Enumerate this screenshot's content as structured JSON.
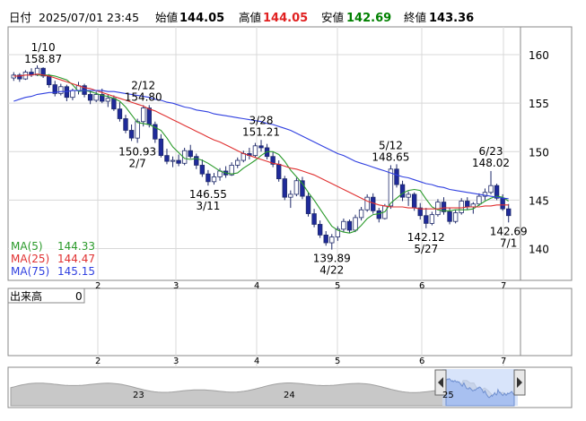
{
  "header": {
    "date_label": "日付",
    "datetime": "2025/07/01 23:45",
    "open_label": "始値",
    "open": "144.05",
    "high_label": "高値",
    "high": "144.05",
    "low_label": "安値",
    "low": "142.69",
    "close_label": "終値",
    "close": "143.36"
  },
  "colors": {
    "up_candle": "#ffffff",
    "down_candle": "#1f2a9a",
    "ma5": "#2a9a2a",
    "ma25": "#e03030",
    "ma75": "#3040e0",
    "grid": "#d8d8d8"
  },
  "volume": {
    "label": "出来高",
    "value": "0"
  },
  "navigator": {
    "labels": [
      "23",
      "24",
      "25"
    ]
  },
  "chart_data": {
    "type": "candlestick",
    "yticks": [
      140,
      145,
      150,
      155,
      160
    ],
    "ylim": [
      137.0,
      162.5
    ],
    "xlim": [
      0,
      135
    ],
    "month_ticks": [
      {
        "label": "2",
        "x": 23
      },
      {
        "label": "3",
        "x": 43
      },
      {
        "label": "4",
        "x": 63
      },
      {
        "label": "5",
        "x": 84
      },
      {
        "label": "6",
        "x": 106
      },
      {
        "label": "7",
        "x": 127
      }
    ],
    "ohlc": [
      [
        157.6,
        158.2,
        157.3,
        157.9
      ],
      [
        157.9,
        158.1,
        157.2,
        157.5
      ],
      [
        157.5,
        158.4,
        157.4,
        158.2
      ],
      [
        158.2,
        158.6,
        157.7,
        157.9
      ],
      [
        157.9,
        158.9,
        157.8,
        158.6
      ],
      [
        158.6,
        158.7,
        157.6,
        157.8
      ],
      [
        157.8,
        158.0,
        156.6,
        156.9
      ],
      [
        156.9,
        157.3,
        155.7,
        156.0
      ],
      [
        156.0,
        157.0,
        155.8,
        156.7
      ],
      [
        156.7,
        156.9,
        155.2,
        155.6
      ],
      [
        155.6,
        156.5,
        155.3,
        156.3
      ],
      [
        156.3,
        157.2,
        155.9,
        156.8
      ],
      [
        156.8,
        157.0,
        155.6,
        155.9
      ],
      [
        155.9,
        156.3,
        154.9,
        155.3
      ],
      [
        155.3,
        156.2,
        155.1,
        155.9
      ],
      [
        155.9,
        156.5,
        155.0,
        155.2
      ],
      [
        155.2,
        155.9,
        154.6,
        155.5
      ],
      [
        155.5,
        155.8,
        154.2,
        154.4
      ],
      [
        154.4,
        155.1,
        153.1,
        153.4
      ],
      [
        153.4,
        153.8,
        151.9,
        152.2
      ],
      [
        152.2,
        152.8,
        151.1,
        151.4
      ],
      [
        151.4,
        153.4,
        150.9,
        153.1
      ],
      [
        153.1,
        154.8,
        152.6,
        154.5
      ],
      [
        154.5,
        154.8,
        152.5,
        152.8
      ],
      [
        152.8,
        153.1,
        150.9,
        151.3
      ],
      [
        151.3,
        151.8,
        149.4,
        149.6
      ],
      [
        149.6,
        150.3,
        148.7,
        149.0
      ],
      [
        149.0,
        149.5,
        148.4,
        149.1
      ],
      [
        149.1,
        149.7,
        148.5,
        148.8
      ],
      [
        148.8,
        150.4,
        148.6,
        150.1
      ],
      [
        150.1,
        150.7,
        149.3,
        149.5
      ],
      [
        149.5,
        149.8,
        148.2,
        148.6
      ],
      [
        148.6,
        149.2,
        147.4,
        147.7
      ],
      [
        147.7,
        148.1,
        146.5,
        146.9
      ],
      [
        146.9,
        147.8,
        146.6,
        147.4
      ],
      [
        147.4,
        148.3,
        147.0,
        148.0
      ],
      [
        148.0,
        148.5,
        147.3,
        147.6
      ],
      [
        147.6,
        148.9,
        147.5,
        148.6
      ],
      [
        148.6,
        149.4,
        148.3,
        149.1
      ],
      [
        149.1,
        150.1,
        148.9,
        149.8
      ],
      [
        149.8,
        150.4,
        149.2,
        149.6
      ],
      [
        149.6,
        150.9,
        149.4,
        150.6
      ],
      [
        150.6,
        151.2,
        150.0,
        150.4
      ],
      [
        150.4,
        150.8,
        149.2,
        149.5
      ],
      [
        149.5,
        150.0,
        148.4,
        148.7
      ],
      [
        148.7,
        149.1,
        146.9,
        147.2
      ],
      [
        147.2,
        147.5,
        145.0,
        145.3
      ],
      [
        145.3,
        146.0,
        144.2,
        145.6
      ],
      [
        145.6,
        147.3,
        145.4,
        147.0
      ],
      [
        147.0,
        147.4,
        145.1,
        145.4
      ],
      [
        145.4,
        145.8,
        143.3,
        143.6
      ],
      [
        143.6,
        144.1,
        142.2,
        142.5
      ],
      [
        142.5,
        142.9,
        141.1,
        141.4
      ],
      [
        141.4,
        141.8,
        140.3,
        140.6
      ],
      [
        140.6,
        141.5,
        139.9,
        141.2
      ],
      [
        141.2,
        142.3,
        140.8,
        142.0
      ],
      [
        142.0,
        143.1,
        141.7,
        142.8
      ],
      [
        142.8,
        143.0,
        141.6,
        141.9
      ],
      [
        141.9,
        143.5,
        141.7,
        143.2
      ],
      [
        143.2,
        144.3,
        142.9,
        144.0
      ],
      [
        144.0,
        145.6,
        143.8,
        145.3
      ],
      [
        145.3,
        145.7,
        143.6,
        143.9
      ],
      [
        143.9,
        144.2,
        142.7,
        143.1
      ],
      [
        143.1,
        144.6,
        143.0,
        144.4
      ],
      [
        144.4,
        148.6,
        144.1,
        148.2
      ],
      [
        148.2,
        148.7,
        146.3,
        146.6
      ],
      [
        146.6,
        147.0,
        144.9,
        145.3
      ],
      [
        145.3,
        145.9,
        144.4,
        145.6
      ],
      [
        145.6,
        145.8,
        143.9,
        144.2
      ],
      [
        144.2,
        144.7,
        143.0,
        143.4
      ],
      [
        143.4,
        144.2,
        142.1,
        142.6
      ],
      [
        142.6,
        143.8,
        142.4,
        143.5
      ],
      [
        143.5,
        145.1,
        143.3,
        144.8
      ],
      [
        144.8,
        145.3,
        143.5,
        143.8
      ],
      [
        143.8,
        144.2,
        142.5,
        142.8
      ],
      [
        142.8,
        144.0,
        142.6,
        143.7
      ],
      [
        143.7,
        145.2,
        143.5,
        144.9
      ],
      [
        144.9,
        145.3,
        144.0,
        144.3
      ],
      [
        144.3,
        144.8,
        143.6,
        144.6
      ],
      [
        144.6,
        145.7,
        144.4,
        145.4
      ],
      [
        145.4,
        146.2,
        145.0,
        145.8
      ],
      [
        145.8,
        148.0,
        145.6,
        146.5
      ],
      [
        146.5,
        146.7,
        145.0,
        145.2
      ],
      [
        145.2,
        145.6,
        143.9,
        144.1
      ],
      [
        144.1,
        144.6,
        142.7,
        143.4
      ]
    ],
    "series": [
      {
        "name": "MA(5)",
        "last": "144.33",
        "values": [
          null,
          null,
          null,
          null,
          157.9,
          157.9,
          157.9,
          157.8,
          157.6,
          157.4,
          156.9,
          156.2,
          156.3,
          156.2,
          156.0,
          155.8,
          155.7,
          155.5,
          155.2,
          154.6,
          153.8,
          153.0,
          152.9,
          152.8,
          152.5,
          152.2,
          151.4,
          150.5,
          149.9,
          149.3,
          149.2,
          149.3,
          149.1,
          148.8,
          148.4,
          148.0,
          147.8,
          147.7,
          147.8,
          148.3,
          148.7,
          149.1,
          149.6,
          150.0,
          150.0,
          149.7,
          149.0,
          148.1,
          147.4,
          146.7,
          145.8,
          145.0,
          144.1,
          143.2,
          142.3,
          141.9,
          141.7,
          141.6,
          141.8,
          142.4,
          143.1,
          143.5,
          143.6,
          143.8,
          144.7,
          145.2,
          145.7,
          146.0,
          146.1,
          146.0,
          145.1,
          144.3,
          144.0,
          143.9,
          143.9,
          144.0,
          144.0,
          144.0,
          144.1,
          144.5,
          144.9,
          145.2,
          145.4,
          145.3,
          144.9
        ]
      },
      {
        "name": "MA(25)",
        "last": "144.47",
        "values": [
          157.8,
          157.8,
          157.9,
          157.9,
          158.0,
          157.9,
          157.8,
          157.6,
          157.4,
          157.2,
          157.0,
          156.8,
          156.6,
          156.5,
          156.3,
          156.1,
          155.9,
          155.7,
          155.5,
          155.3,
          155.1,
          154.9,
          154.7,
          154.4,
          154.2,
          153.9,
          153.6,
          153.3,
          153.0,
          152.7,
          152.4,
          152.1,
          151.8,
          151.5,
          151.2,
          151.0,
          150.7,
          150.4,
          150.1,
          149.8,
          149.6,
          149.4,
          149.2,
          149.0,
          148.8,
          148.7,
          148.5,
          148.3,
          148.2,
          148.0,
          147.8,
          147.6,
          147.3,
          147.0,
          146.7,
          146.4,
          146.1,
          145.8,
          145.5,
          145.2,
          144.9,
          144.7,
          144.5,
          144.4,
          144.3,
          144.3,
          144.3,
          144.2,
          144.2,
          144.1,
          144.1,
          144.1,
          144.1,
          144.2,
          144.2,
          144.2,
          144.2,
          144.3,
          144.3,
          144.3,
          144.4,
          144.4,
          144.5,
          144.5,
          144.5
        ]
      },
      {
        "name": "MA(75)",
        "last": "145.15",
        "values": [
          155.2,
          155.4,
          155.6,
          155.7,
          155.9,
          156.0,
          156.1,
          156.1,
          156.2,
          156.2,
          156.3,
          156.3,
          156.3,
          156.3,
          156.3,
          156.3,
          156.2,
          156.2,
          156.1,
          156.0,
          155.9,
          155.8,
          155.7,
          155.6,
          155.4,
          155.3,
          155.1,
          155.0,
          154.8,
          154.6,
          154.5,
          154.3,
          154.2,
          154.1,
          153.9,
          153.8,
          153.7,
          153.6,
          153.5,
          153.4,
          153.3,
          153.2,
          153.1,
          152.9,
          152.8,
          152.6,
          152.4,
          152.2,
          151.9,
          151.6,
          151.3,
          151.0,
          150.7,
          150.4,
          150.1,
          149.8,
          149.6,
          149.3,
          149.0,
          148.8,
          148.6,
          148.4,
          148.2,
          148.0,
          147.8,
          147.6,
          147.4,
          147.3,
          147.1,
          146.9,
          146.7,
          146.6,
          146.4,
          146.3,
          146.1,
          146.0,
          145.9,
          145.8,
          145.7,
          145.6,
          145.5,
          145.4,
          145.3,
          145.2,
          145.15
        ]
      }
    ],
    "annotations": [
      {
        "date": "1/10",
        "value": "158.87",
        "i": 5,
        "pos": "above"
      },
      {
        "date": "2/12",
        "value": "154.80",
        "i": 22,
        "pos": "above"
      },
      {
        "date": "2/7",
        "value": "150.93",
        "i": 21,
        "pos": "below"
      },
      {
        "date": "3/28",
        "value": "151.21",
        "i": 42,
        "pos": "above"
      },
      {
        "date": "3/11",
        "value": "146.55",
        "i": 33,
        "pos": "below"
      },
      {
        "date": "4/22",
        "value": "139.89",
        "i": 54,
        "pos": "below"
      },
      {
        "date": "5/12",
        "value": "148.65",
        "i": 64,
        "pos": "above"
      },
      {
        "date": "5/27",
        "value": "142.12",
        "i": 70,
        "pos": "below"
      },
      {
        "date": "6/23",
        "value": "148.02",
        "i": 81,
        "pos": "above"
      },
      {
        "date": "7/1",
        "value": "142.69",
        "i": 84,
        "pos": "below"
      }
    ]
  }
}
